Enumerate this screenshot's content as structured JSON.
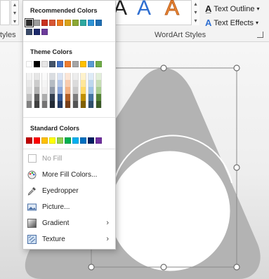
{
  "ribbon": {
    "styles_label": "tyles",
    "wordart_styles_label": "WordArt Styles",
    "text_outline_label": "Text Outline",
    "text_effects_label": "Text Effects",
    "wordart_glyph": "A"
  },
  "panel": {
    "recommended_title": "Recommended Colors",
    "theme_title": "Theme Colors",
    "standard_title": "Standard Colors",
    "recommended_colors": [
      "#2b2b2b",
      "#9c9c9c",
      "#c8311f",
      "#d75634",
      "#ec7a1e",
      "#d9a21a",
      "#8ca834",
      "#2ea8a0",
      "#2f94d6",
      "#1f6fb3",
      "#3a4a69",
      "#1c2a6b",
      "#6c3b9a"
    ],
    "theme_top": [
      "#ffffff",
      "#000000",
      "#e7e6e6",
      "#44546a",
      "#4472c4",
      "#ed7d31",
      "#a5a5a5",
      "#ffc000",
      "#5b9bd5",
      "#70ad47"
    ],
    "standard_colors": [
      "#c00000",
      "#ff0000",
      "#ffc000",
      "#ffff00",
      "#92d050",
      "#00b050",
      "#00b0f0",
      "#0070c0",
      "#002060",
      "#7030a0"
    ],
    "menu": [
      {
        "label": "No Fill",
        "icon": "no-fill-icon",
        "enabled": false
      },
      {
        "label": "More Fill Colors...",
        "icon": "palette-icon",
        "enabled": true
      },
      {
        "label": "Eyedropper",
        "icon": "eyedropper-icon",
        "enabled": true
      },
      {
        "label": "Picture...",
        "icon": "picture-icon",
        "enabled": true
      },
      {
        "label": "Gradient",
        "icon": "gradient-icon",
        "enabled": true,
        "submenu": true
      },
      {
        "label": "Texture",
        "icon": "texture-icon",
        "enabled": true,
        "submenu": true
      }
    ]
  },
  "colors": {
    "shape_fill": "#b3b3b3",
    "handle_stroke": "#6f6f6f"
  }
}
